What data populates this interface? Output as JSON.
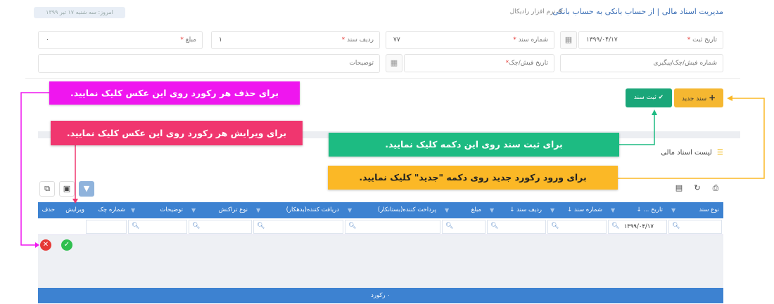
{
  "header": {
    "title": "مدیریت اسناد مالی | از حساب بانکی به حساب بانکی",
    "app_name": "# نرم افزار رادیکال",
    "badge": "امروز: سه شنبه ۱۷ تیر ۱۳۹۹"
  },
  "form": {
    "reg_date": {
      "label": "تاریخ ثبت",
      "value": "۱۳۹۹/۰۴/۱۷"
    },
    "doc_number": {
      "label": "شماره سند",
      "value": "۷۷"
    },
    "doc_row": {
      "label": "ردیف سند",
      "value": "۱"
    },
    "amount": {
      "label": "مبلغ",
      "value": "۰"
    },
    "receipt_number": {
      "label": "شماره فیش/چک/پیگیری"
    },
    "receipt_date": {
      "label": "تاریخ فیش/چک"
    },
    "description": {
      "label": "توضیحات"
    },
    "required_mark": "*",
    "calendar_icon": "calendar-icon"
  },
  "actions": {
    "new_label": "سند جدید",
    "save_label": "ثبت سند",
    "new_icon": "+",
    "save_icon": "✔"
  },
  "callouts": {
    "delete": "برای حذف هر رکورد روی این عکس کلیک نمایید.",
    "edit": "برای ویرایش هر رکورد روی این عکس کلیک نمایید.",
    "save": "برای ثبت سند روی این دکمه کلیک نمایید.",
    "new": "برای ورود رکورد جدید روی دکمه \"جدید\" کلیک نمایید."
  },
  "list": {
    "title": "لیست اسناد مالی",
    "columns": [
      {
        "key": "doc_type",
        "label": "نوع سند"
      },
      {
        "key": "reg_date",
        "label": "تاریخ ...",
        "sort": "↓"
      },
      {
        "key": "doc_number",
        "label": "شماره سند",
        "sort": "↓"
      },
      {
        "key": "doc_row",
        "label": "ردیف سند",
        "sort": "↓"
      },
      {
        "key": "amount",
        "label": "مبلغ"
      },
      {
        "key": "payer",
        "label": "پرداخت کننده(بستانکار)"
      },
      {
        "key": "receiver",
        "label": "دریافت کننده(بدهکار)"
      },
      {
        "key": "transaction_type",
        "label": "نوع تراکنش"
      },
      {
        "key": "description",
        "label": "توضیحات"
      },
      {
        "key": "check_number",
        "label": "شماره چک"
      },
      {
        "key": "edit",
        "label": "ویرایش"
      },
      {
        "key": "delete",
        "label": "حذف"
      }
    ],
    "filter_date_value": "۱۳۹۹/۰۴/۱۷",
    "footer": "۰ رکورد",
    "colors": {
      "header": "#3d82d1",
      "edit": "#2fbf4f",
      "delete": "#e53935"
    }
  }
}
